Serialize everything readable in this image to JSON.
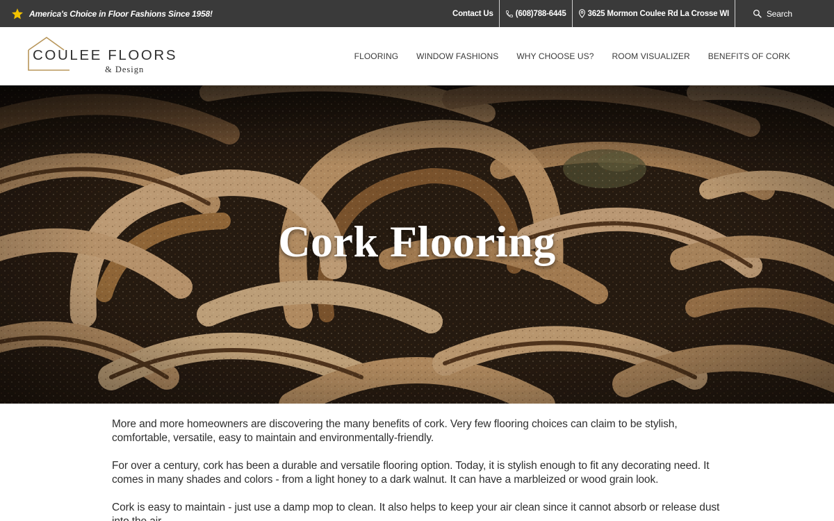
{
  "topbar": {
    "tagline": "America's Choice in Floor Fashions Since 1958!",
    "contact_label": "Contact Us",
    "phone": "(608)788-6445",
    "address": "3625 Mormon Coulee Rd La Crosse WI",
    "search_label": "Search",
    "icons": [
      "star-icon",
      "phone-icon",
      "map-pin-icon",
      "search-icon"
    ],
    "star_color": "#f2c200"
  },
  "logo": {
    "brand": "COULEE FLOORS",
    "sub": "& Design",
    "accent_color": "#b8965a"
  },
  "nav": {
    "items": [
      "FLOORING",
      "WINDOW FASHIONS",
      "WHY CHOOSE US?",
      "ROOM VISUALIZER",
      "BENEFITS OF CORK"
    ]
  },
  "hero": {
    "title": "Cork Flooring"
  },
  "content": {
    "paragraphs": [
      "More and more homeowners are discovering the many benefits of cork. Very few flooring choices can claim to be stylish, comfortable, versatile, easy to maintain and environmentally-friendly.",
      "For over a century, cork has been a durable and versatile flooring option. Today, it is stylish enough to fit any decorating need. It comes in many shades and colors - from a light honey to a dark walnut. It can have a marbleized or wood grain look.",
      "Cork is easy to maintain - just use a damp mop to clean. It also helps to keep your air clean since it cannot absorb or release dust into the air."
    ]
  }
}
